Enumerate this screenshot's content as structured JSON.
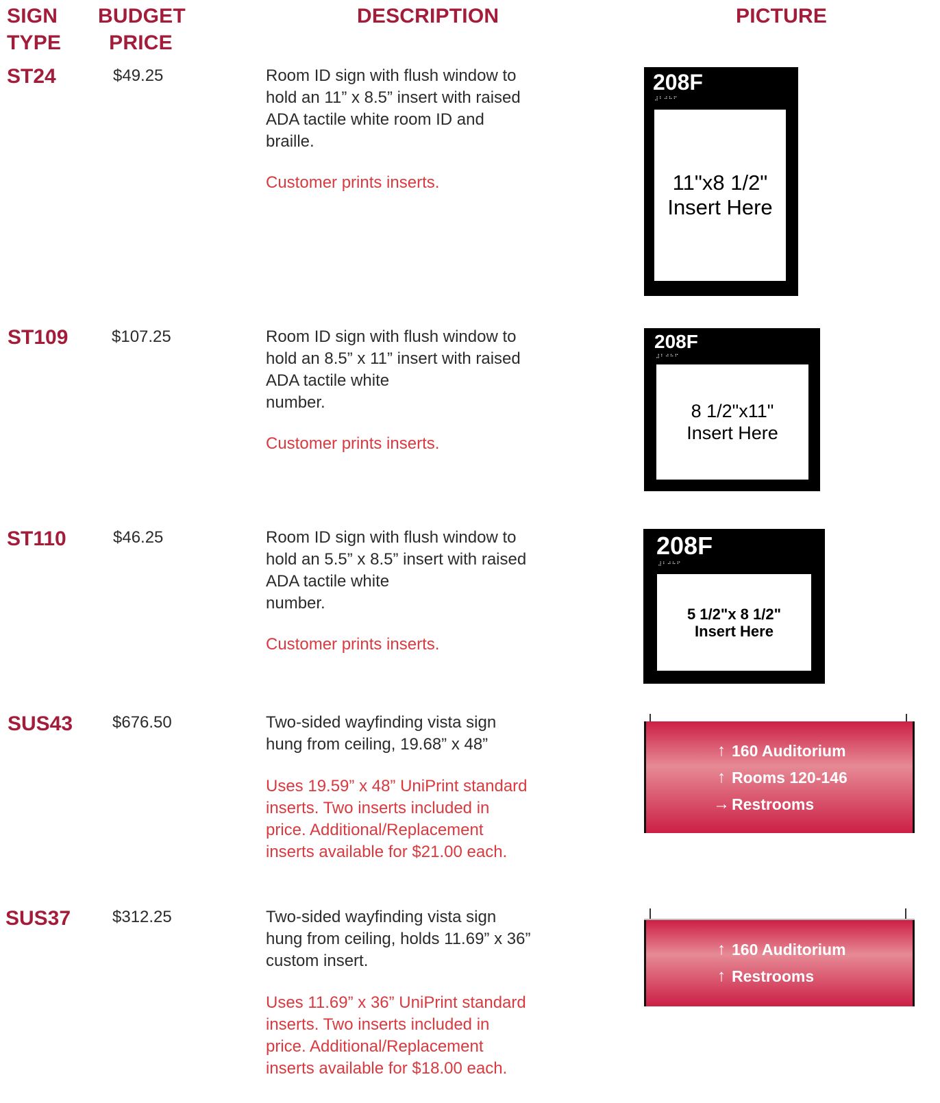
{
  "headers": {
    "sign_type": [
      "SIGN",
      "TYPE"
    ],
    "budget_price": [
      "BUDGET",
      "PRICE"
    ],
    "description": "DESCRIPTION",
    "picture": "PICTURE"
  },
  "rows": [
    {
      "code": "ST24",
      "price": "$49.25",
      "description": [
        "Room ID sign with flush window to",
        "hold an 11” x 8.5” insert with raised",
        "ADA tactile white room ID and",
        "braille."
      ],
      "note": [
        "Customer prints inserts."
      ],
      "picture": {
        "number": "208F",
        "braille": "⠼⠃⠚⠓⠋",
        "insert": [
          "11\"x8 1/2\"",
          "Insert Here"
        ]
      }
    },
    {
      "code": "ST109",
      "price": "$107.25",
      "description": [
        "Room ID sign with flush window to",
        "hold an 8.5” x 11” insert with raised",
        "ADA tactile white",
        "number."
      ],
      "note": [
        "Customer prints inserts."
      ],
      "picture": {
        "number": "208F",
        "braille": "⠼⠃⠚⠓⠋",
        "insert": [
          "8 1/2\"x11\"",
          "Insert Here"
        ]
      }
    },
    {
      "code": "ST110",
      "price": "$46.25",
      "description": [
        "Room ID sign with flush window to",
        "hold an 5.5” x 8.5” insert with raised",
        "ADA tactile white",
        "number."
      ],
      "note": [
        "Customer prints inserts."
      ],
      "picture": {
        "number": "208F",
        "braille": "⠼⠃⠚⠓⠋",
        "insert": [
          "5 1/2\"x 8 1/2\"",
          "Insert Here"
        ]
      }
    },
    {
      "code": "SUS43",
      "price": "$676.50",
      "description": [
        "Two-sided wayfinding vista sign",
        "hung from ceiling, 19.68” x 48”"
      ],
      "note": [
        "Uses 19.59” x 48” UniPrint standard",
        "inserts. Two inserts included in",
        "price. Additional/Replacement",
        "inserts available for $21.00 each."
      ],
      "picture": {
        "lines": [
          {
            "arrow": "up-arrow-icon",
            "text": "160 Auditorium"
          },
          {
            "arrow": "up-arrow-icon",
            "text": "Rooms 120-146"
          },
          {
            "arrow": "right-arrow-icon",
            "text": "Restrooms"
          }
        ]
      }
    },
    {
      "code": "SUS37",
      "price": "$312.25",
      "description": [
        "Two-sided wayfinding vista sign",
        "hung from ceiling, holds 11.69” x 36”",
        "custom insert."
      ],
      "note": [
        "Uses 11.69” x 36” UniPrint standard",
        "inserts. Two inserts included in",
        "price. Additional/Replacement",
        "inserts available for $18.00 each."
      ],
      "picture": {
        "lines": [
          {
            "arrow": "up-arrow-icon",
            "text": "160 Auditorium"
          },
          {
            "arrow": "up-arrow-icon",
            "text": "Restrooms"
          }
        ]
      }
    }
  ],
  "colors": {
    "heading": "#a31c3a",
    "note": "#d83a3f",
    "vista_red": "#cc1f45"
  }
}
